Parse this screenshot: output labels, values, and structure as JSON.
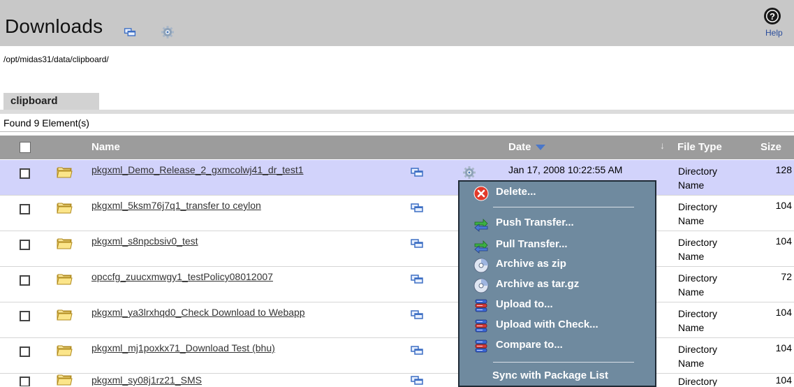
{
  "header": {
    "title": "Downloads",
    "help_label": "Help"
  },
  "path": "/opt/midas31/data/clipboard/",
  "tab": {
    "label": "clipboard"
  },
  "found": "Found 9 Element(s)",
  "columns": {
    "name": "Name",
    "date": "Date",
    "file_type": "File Type",
    "size": "Size"
  },
  "rows": [
    {
      "name": "pkgxml_Demo_Release_2_gxmcolwj41_dr_test1",
      "date": "Jan 17, 2008 10:22:55 AM",
      "file_type": "Directory Name",
      "size": "128"
    },
    {
      "name": "pkgxml_5ksm76j7q1_transfer to ceylon",
      "date": "",
      "file_type": "Directory Name",
      "size": "104"
    },
    {
      "name": "pkgxml_s8npcbsiv0_test",
      "date": "",
      "file_type": "Directory Name",
      "size": "104"
    },
    {
      "name": "opccfg_zuucxmwgy1_testPolicy08012007",
      "date": "",
      "file_type": "Directory Name",
      "size": "72"
    },
    {
      "name": "pkgxml_ya3lrxhqd0_Check Download to Webapp",
      "date": "",
      "file_type": "Directory Name",
      "size": "104"
    },
    {
      "name": "pkgxml_mj1poxkx71_Download Test (bhu)",
      "date": "",
      "file_type": "Directory Name",
      "size": "104"
    },
    {
      "name": "pkgxml_sy08j1rz21_SMS",
      "date": "",
      "file_type": "Directory",
      "size": "104"
    }
  ],
  "context_menu": {
    "items": [
      {
        "label": "Delete...",
        "icon": "delete-icon"
      },
      {
        "label": "Push Transfer...",
        "icon": "push-transfer-icon"
      },
      {
        "label": "Pull Transfer...",
        "icon": "pull-transfer-icon"
      },
      {
        "label": "Archive as zip",
        "icon": "disc-icon"
      },
      {
        "label": "Archive as tar.gz",
        "icon": "disc-icon"
      },
      {
        "label": "Upload to...",
        "icon": "server-icon"
      },
      {
        "label": "Upload with Check...",
        "icon": "server-icon"
      },
      {
        "label": "Compare to...",
        "icon": "server-icon"
      },
      {
        "label": "Sync with Package List",
        "icon": ""
      }
    ]
  },
  "colors": {
    "header_bg": "#c8c8c8",
    "table_header_bg": "#9c9c9c",
    "highlight_row": "#d2d3fb",
    "menu_bg": "#6f8a9f",
    "link": "#333333",
    "sort_arrow": "#4a77c9"
  }
}
